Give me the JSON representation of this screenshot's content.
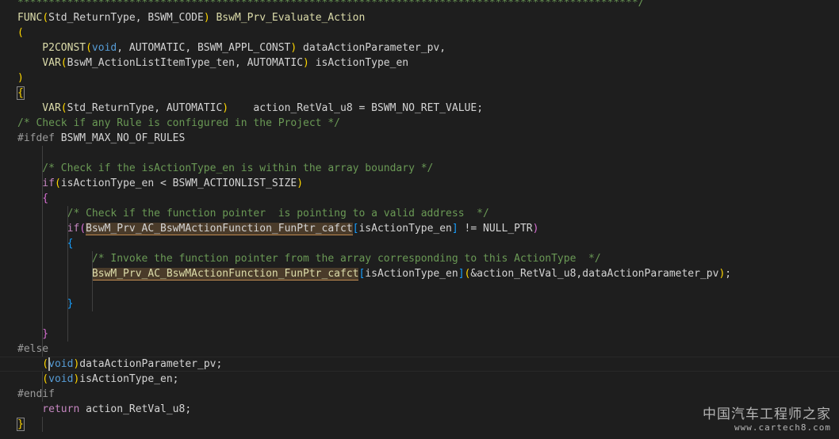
{
  "editor": {
    "lines": [
      {
        "text": "****************************************************************************************************/",
        "class": "c-comment"
      },
      {
        "tokens": [
          {
            "t": "FUNC",
            "c": "c-macro"
          },
          {
            "t": "(",
            "c": "c-paren"
          },
          {
            "t": "Std_ReturnType, BSWM_CODE",
            "c": "c-text"
          },
          {
            "t": ")",
            "c": "c-paren"
          },
          {
            "t": " BswM_Prv_Evaluate_Action",
            "c": "c-ident"
          }
        ]
      },
      {
        "tokens": [
          {
            "t": "(",
            "c": "c-paren"
          }
        ]
      },
      {
        "tokens": [
          {
            "t": "    P2CONST",
            "c": "c-macro"
          },
          {
            "t": "(",
            "c": "c-paren"
          },
          {
            "t": "void",
            "c": "c-kw"
          },
          {
            "t": ", AUTOMATIC, BSWM_APPL_CONST",
            "c": "c-text"
          },
          {
            "t": ")",
            "c": "c-paren"
          },
          {
            "t": " dataActionParameter_pv,",
            "c": "c-text"
          }
        ]
      },
      {
        "tokens": [
          {
            "t": "    VAR",
            "c": "c-macro"
          },
          {
            "t": "(",
            "c": "c-paren"
          },
          {
            "t": "BswM_ActionListItemType_ten, AUTOMATIC",
            "c": "c-text"
          },
          {
            "t": ")",
            "c": "c-paren"
          },
          {
            "t": " isActionType_en",
            "c": "c-text"
          }
        ]
      },
      {
        "tokens": [
          {
            "t": ")",
            "c": "c-paren"
          }
        ]
      },
      {
        "tokens": [
          {
            "t": "{",
            "c": "c-brace1 bracket-match"
          }
        ]
      },
      {
        "tokens": [
          {
            "t": "    VAR",
            "c": "c-macro"
          },
          {
            "t": "(",
            "c": "c-paren"
          },
          {
            "t": "Std_ReturnType, AUTOMATIC",
            "c": "c-text"
          },
          {
            "t": ")",
            "c": "c-paren"
          },
          {
            "t": "    action_RetVal_u8 = BSWM_NO_RET_VALUE;",
            "c": "c-text"
          }
        ]
      },
      {
        "text": "/* Check if any Rule is configured in the Project */",
        "class": "c-comment"
      },
      {
        "tokens": [
          {
            "t": "#ifdef",
            "c": "c-pre"
          },
          {
            "t": " BSWM_MAX_NO_OF_RULES",
            "c": "c-text"
          }
        ]
      },
      {
        "text": ""
      },
      {
        "text": "    /* Check if the isActionType_en is within the array boundary */",
        "class": "c-comment"
      },
      {
        "tokens": [
          {
            "t": "    if",
            "c": "c-ctrl"
          },
          {
            "t": "(",
            "c": "c-paren"
          },
          {
            "t": "isActionType_en < BSWM_ACTIONLIST_SIZE",
            "c": "c-text"
          },
          {
            "t": ")",
            "c": "c-paren"
          }
        ]
      },
      {
        "tokens": [
          {
            "t": "    {",
            "c": "c-brace2"
          }
        ]
      },
      {
        "text": "        /* Check if the function pointer  is pointing to a valid address  */",
        "class": "c-comment"
      },
      {
        "tokens": [
          {
            "t": "        if",
            "c": "c-ctrl"
          },
          {
            "t": "(",
            "c": "c-brace2"
          },
          {
            "t": "BswM_Prv_AC_BswMActionFunction_FunPtr_cafct",
            "c": "c-text hl"
          },
          {
            "t": "[",
            "c": "c-brace3"
          },
          {
            "t": "isActionType_en",
            "c": "c-text"
          },
          {
            "t": "]",
            "c": "c-brace3"
          },
          {
            "t": " != NULL_PTR",
            "c": "c-text"
          },
          {
            "t": ")",
            "c": "c-brace2"
          }
        ]
      },
      {
        "tokens": [
          {
            "t": "        {",
            "c": "c-brace3"
          }
        ]
      },
      {
        "text": "            /* Invoke the function pointer from the array corresponding to this ActionType  */",
        "class": "c-comment"
      },
      {
        "tokens": [
          {
            "t": "            ",
            "c": "c-text"
          },
          {
            "t": "BswM_Prv_AC_BswMActionFunction_FunPtr_cafct",
            "c": "c-ident hl"
          },
          {
            "t": "[",
            "c": "c-brace3"
          },
          {
            "t": "isActionType_en",
            "c": "c-text"
          },
          {
            "t": "]",
            "c": "c-brace3"
          },
          {
            "t": "(",
            "c": "c-brace1"
          },
          {
            "t": "&action_RetVal_u8,dataActionParameter_pv",
            "c": "c-text"
          },
          {
            "t": ")",
            "c": "c-brace1"
          },
          {
            "t": ";",
            "c": "c-text"
          }
        ]
      },
      {
        "text": ""
      },
      {
        "tokens": [
          {
            "t": "        }",
            "c": "c-brace3"
          }
        ]
      },
      {
        "text": ""
      },
      {
        "tokens": [
          {
            "t": "    }",
            "c": "c-brace2"
          }
        ]
      },
      {
        "tokens": [
          {
            "t": "#else",
            "c": "c-pre"
          }
        ]
      },
      {
        "tokens": [
          {
            "t": "    (",
            "c": "c-paren"
          },
          {
            "t": "void",
            "c": "c-kw"
          },
          {
            "t": ")",
            "c": "c-paren"
          },
          {
            "t": "dataActionParameter_pv;",
            "c": "c-text"
          }
        ]
      },
      {
        "tokens": [
          {
            "t": "    (",
            "c": "c-paren"
          },
          {
            "t": "void",
            "c": "c-kw"
          },
          {
            "t": ")",
            "c": "c-paren"
          },
          {
            "t": "isActionType_en;",
            "c": "c-text"
          }
        ]
      },
      {
        "tokens": [
          {
            "t": "#endif",
            "c": "c-pre"
          }
        ]
      },
      {
        "tokens": [
          {
            "t": "    return",
            "c": "c-ctrl"
          },
          {
            "t": " action_RetVal_u8;",
            "c": "c-text"
          }
        ]
      },
      {
        "tokens": [
          {
            "t": "}",
            "c": "c-brace1 bracket-match"
          }
        ]
      }
    ]
  },
  "watermark": {
    "text_cn": "中国汽车工程师之家",
    "url": "www.cartech8.com"
  }
}
